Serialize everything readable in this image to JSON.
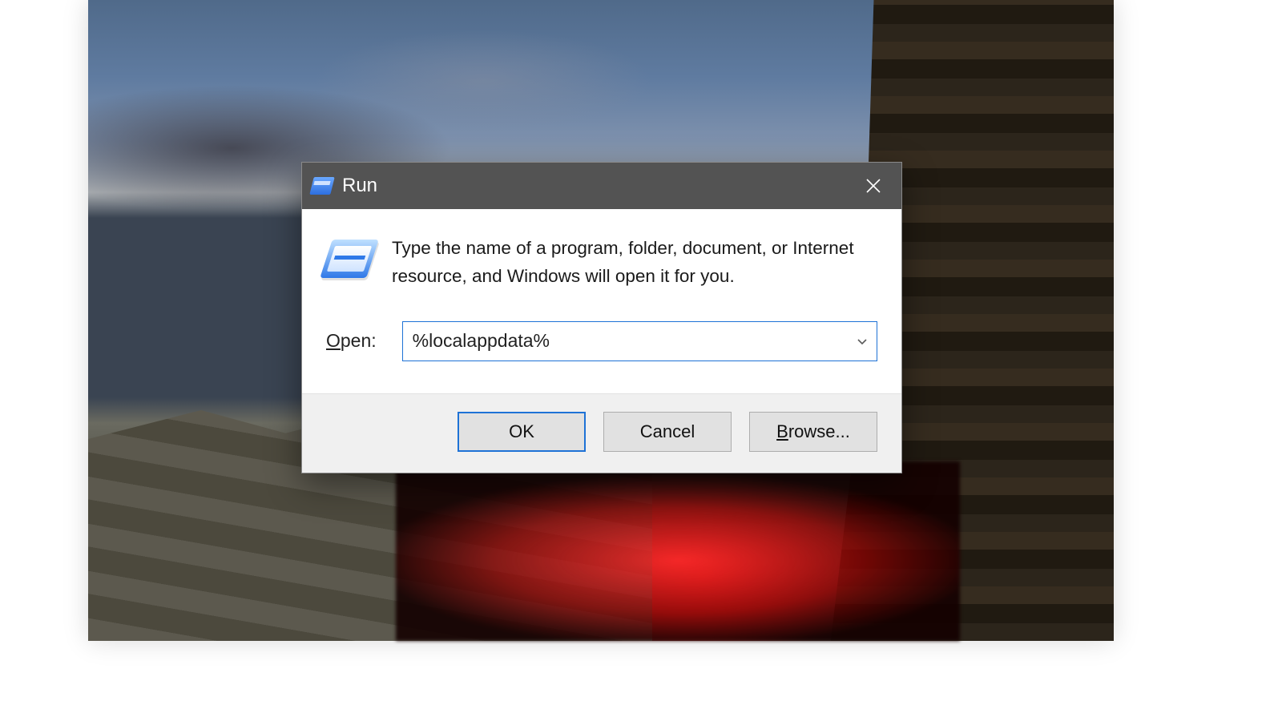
{
  "dialog": {
    "title": "Run",
    "description": "Type the name of a program, folder, document, or Internet resource, and Windows will open it for you.",
    "open_label_prefix": "O",
    "open_label_rest": "pen:",
    "input_value": "%localappdata%",
    "buttons": {
      "ok": "OK",
      "cancel": "Cancel",
      "browse_prefix": "B",
      "browse_rest": "rowse..."
    }
  }
}
